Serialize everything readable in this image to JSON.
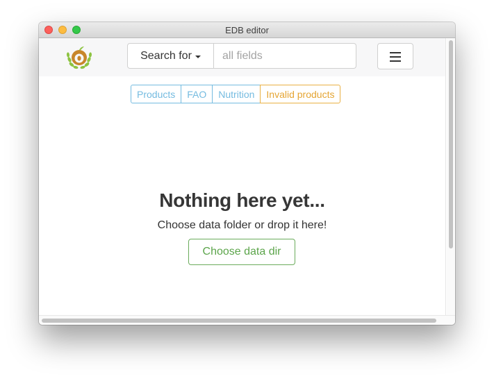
{
  "window": {
    "title": "EDB editor"
  },
  "navbar": {
    "search_button_label": "Search for",
    "search_placeholder": "all fields",
    "menu_button": "hamburger-icon"
  },
  "tabs": [
    {
      "label": "Products",
      "style": "info"
    },
    {
      "label": "FAO",
      "style": "info"
    },
    {
      "label": "Nutrition",
      "style": "info"
    },
    {
      "label": "Invalid products",
      "style": "warning"
    }
  ],
  "empty_state": {
    "title": "Nothing here yet...",
    "subtitle": "Choose data folder or drop it here!",
    "button_label": "Choose data dir"
  },
  "colors": {
    "info": "#74bbe0",
    "warning": "#e9b043",
    "success": "#6aab5b",
    "logo_gold": "#c8862b",
    "logo_green": "#8dc341"
  }
}
